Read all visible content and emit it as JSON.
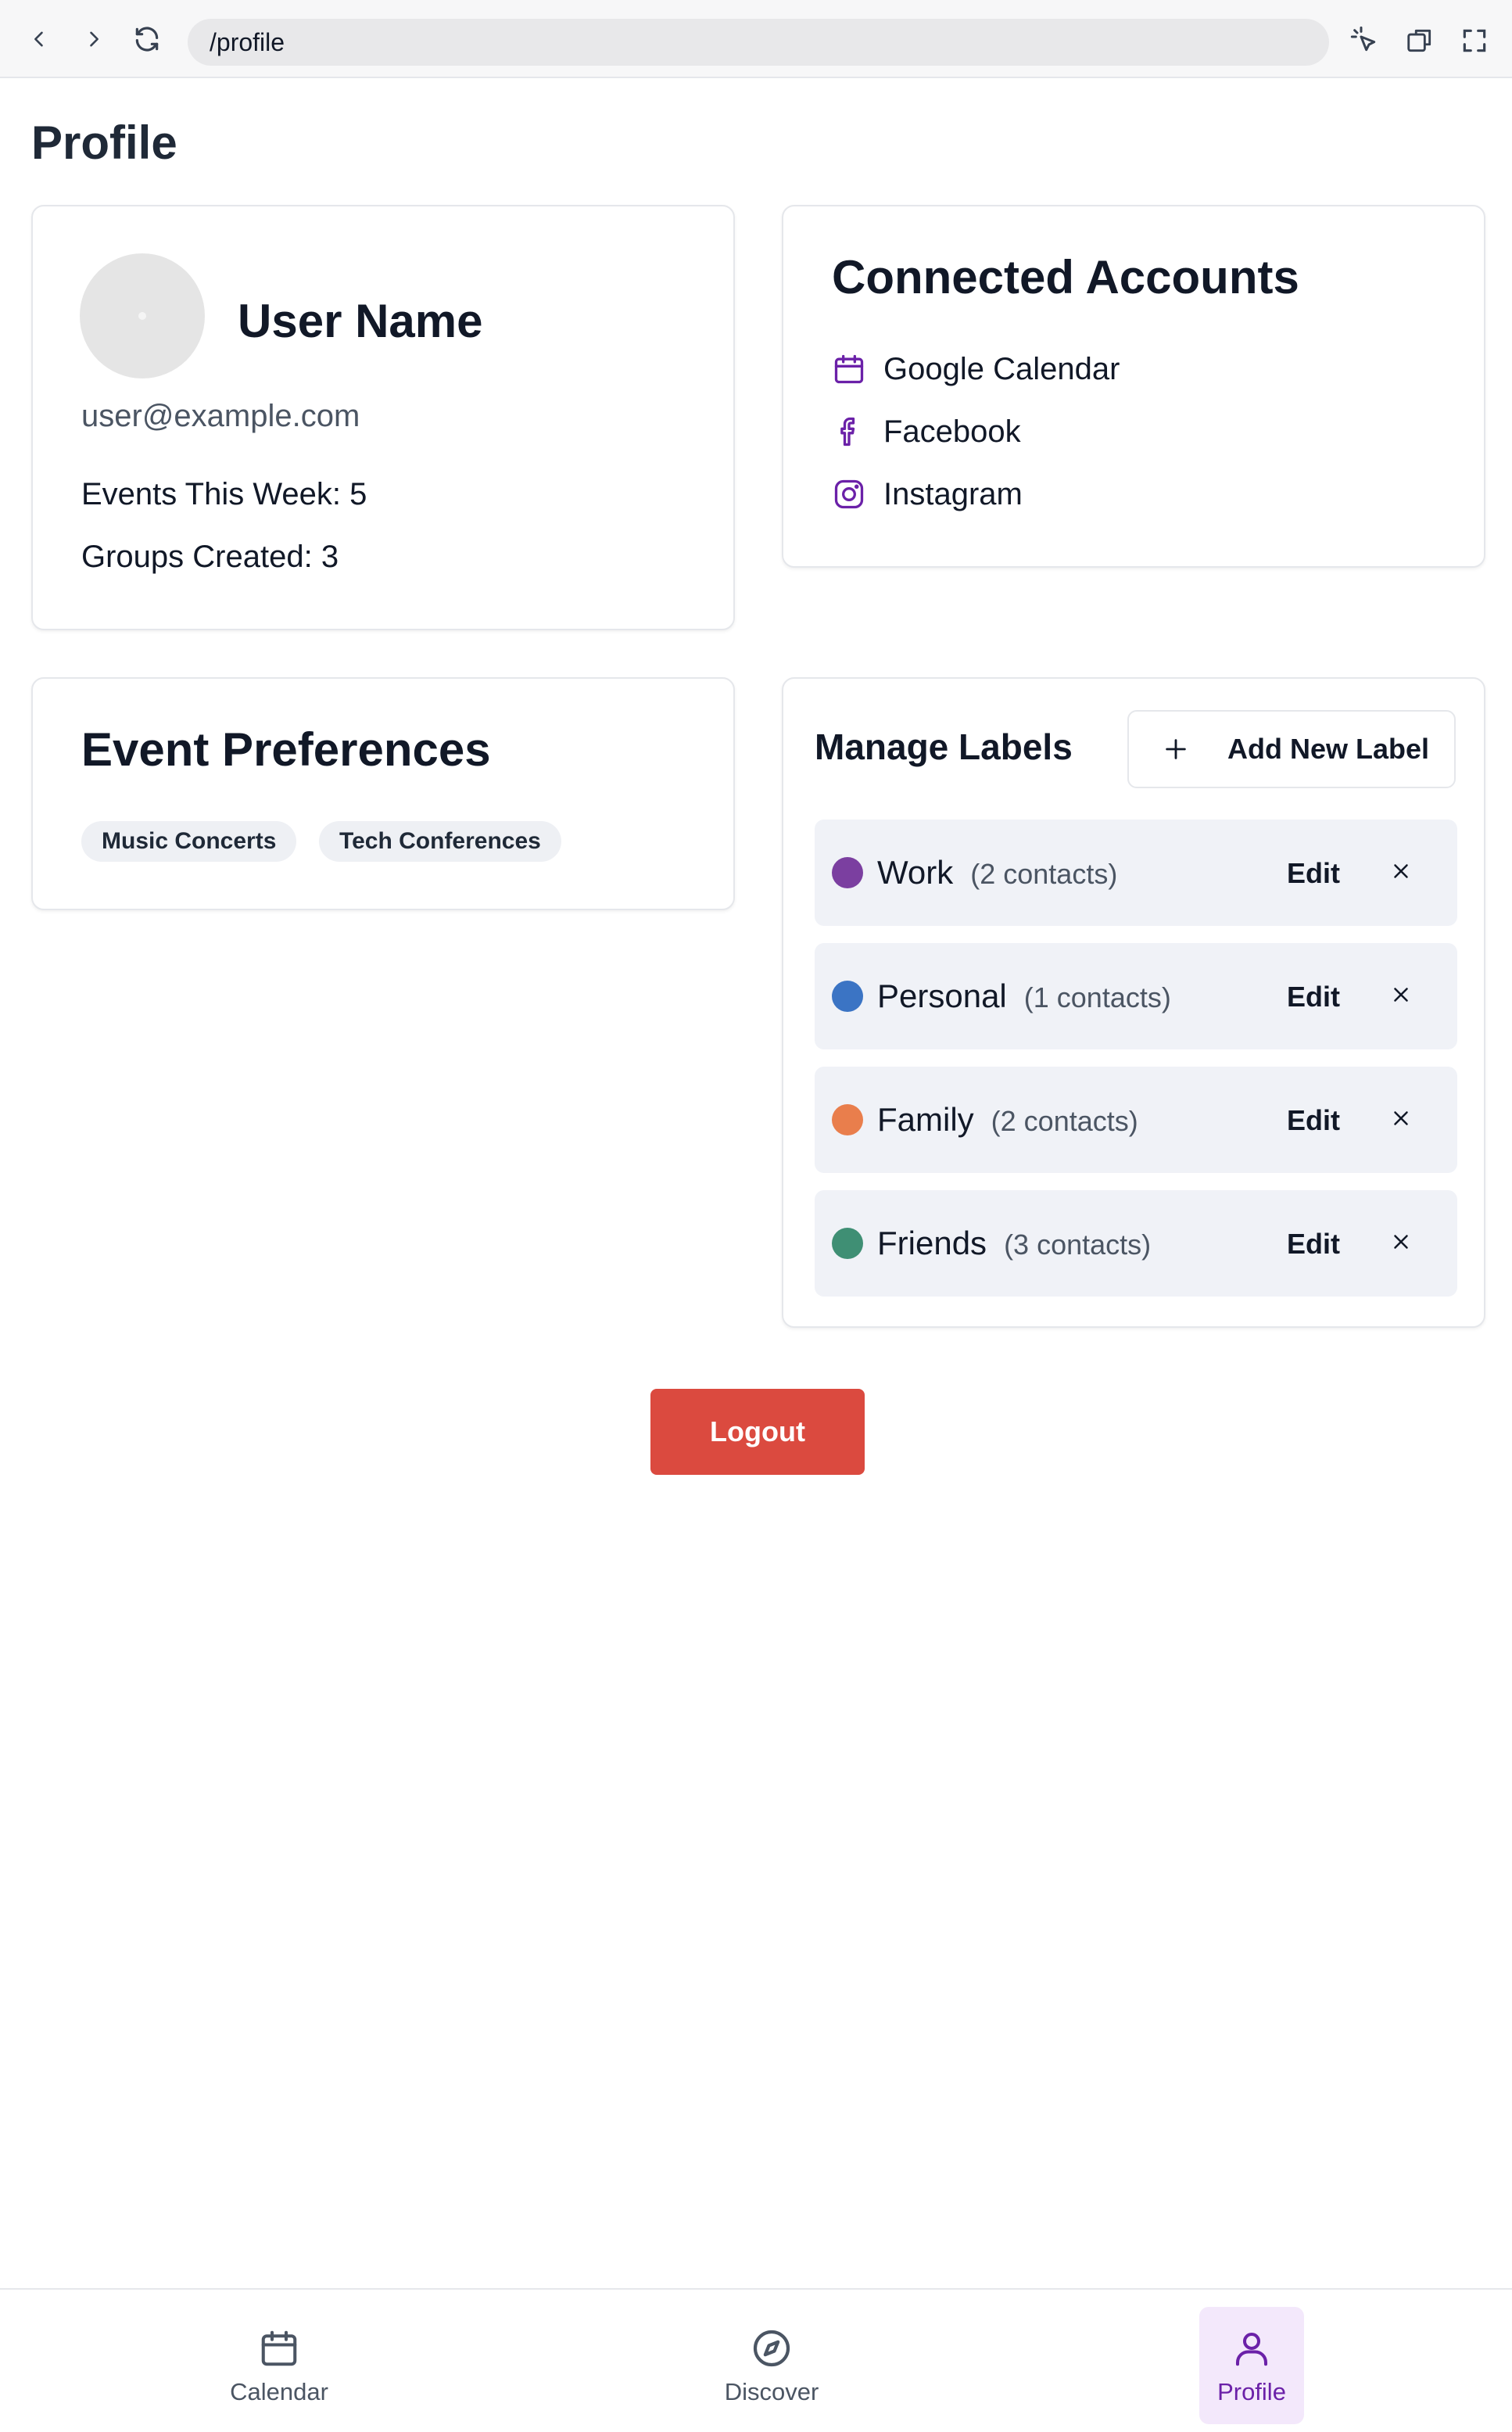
{
  "browser": {
    "url": "/profile"
  },
  "page": {
    "title": "Profile"
  },
  "profile": {
    "name": "User Name",
    "email": "user@example.com",
    "events_this_week": "Events This Week: 5",
    "groups_created": "Groups Created: 3"
  },
  "connected_accounts": {
    "title": "Connected Accounts",
    "items": [
      {
        "label": "Google Calendar",
        "icon": "calendar-icon"
      },
      {
        "label": "Facebook",
        "icon": "facebook-icon"
      },
      {
        "label": "Instagram",
        "icon": "instagram-icon"
      }
    ]
  },
  "event_preferences": {
    "title": "Event Preferences",
    "tags": [
      "Music Concerts",
      "Tech Conferences"
    ]
  },
  "labels": {
    "title": "Manage Labels",
    "add_label": "Add New Label",
    "edit_label": "Edit",
    "items": [
      {
        "name": "Work",
        "count": "(2 contacts)",
        "color": "#7b3fa0"
      },
      {
        "name": "Personal",
        "count": "(1 contacts)",
        "color": "#3b74c4"
      },
      {
        "name": "Family",
        "count": "(2 contacts)",
        "color": "#e97e4c"
      },
      {
        "name": "Friends",
        "count": "(3 contacts)",
        "color": "#3f8f74"
      }
    ]
  },
  "logout_label": "Logout",
  "bottom_nav": {
    "items": [
      {
        "label": "Calendar",
        "icon": "calendar-icon",
        "active": false
      },
      {
        "label": "Discover",
        "icon": "compass-icon",
        "active": false
      },
      {
        "label": "Profile",
        "icon": "user-icon",
        "active": true
      }
    ]
  },
  "colors": {
    "accent": "#6b21a8",
    "danger": "#db4a3f"
  }
}
